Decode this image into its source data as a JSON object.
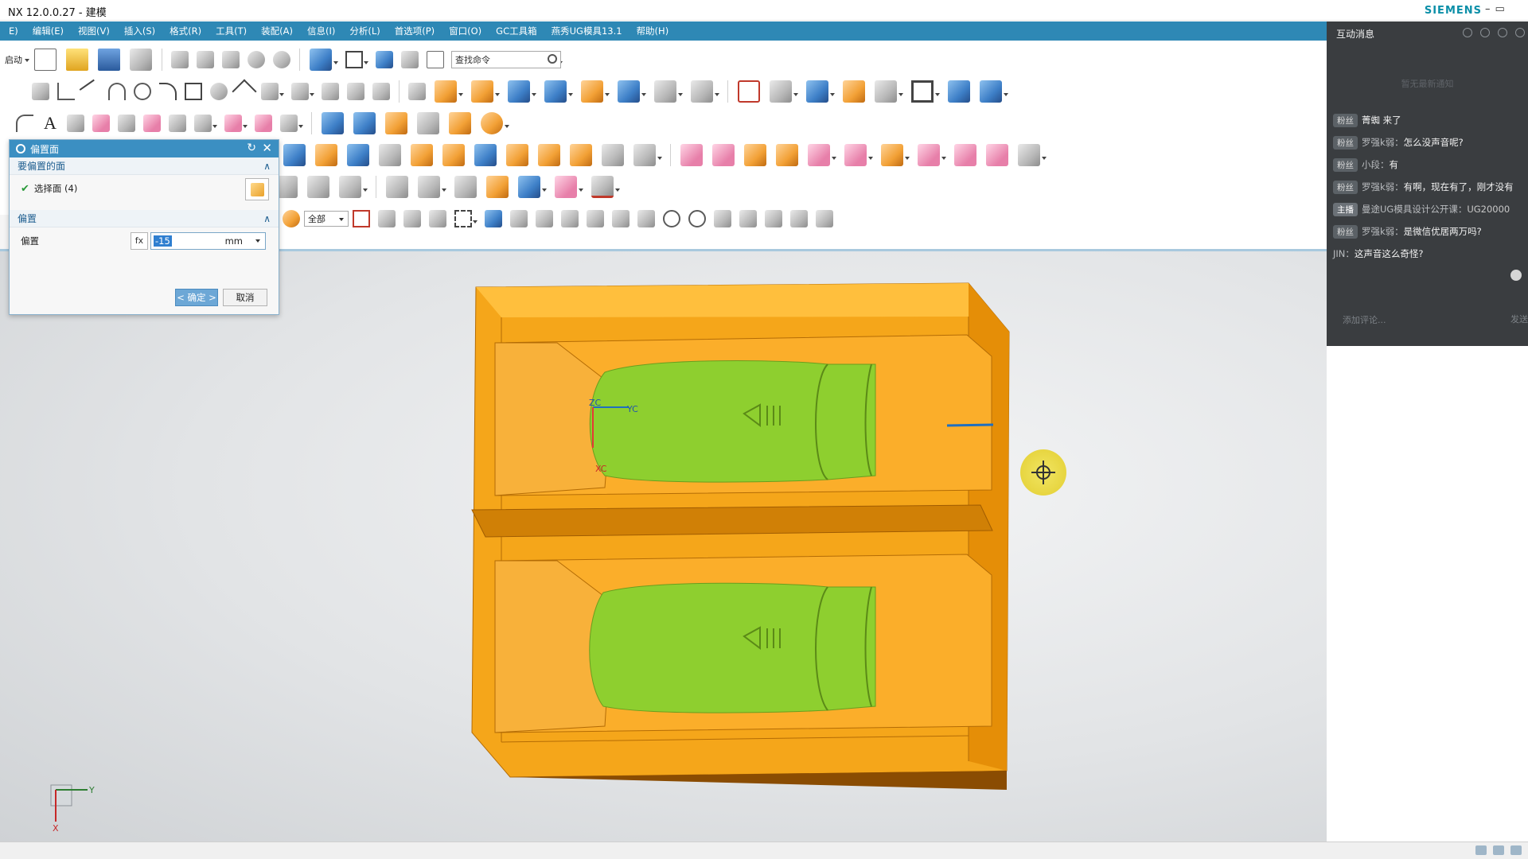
{
  "window": {
    "title": "NX 12.0.0.27 - 建模",
    "brand": "SIEMENS",
    "minimize": "–",
    "restore": "▭"
  },
  "menu": [
    "E)",
    "编辑(E)",
    "视图(V)",
    "插入(S)",
    "格式(R)",
    "工具(T)",
    "装配(A)",
    "信息(I)",
    "分析(L)",
    "首选项(P)",
    "窗口(O)",
    "GC工具箱",
    "燕秀UG模具13.1",
    "帮助(H)"
  ],
  "toolbar": {
    "start_label": "启动",
    "search_placeholder": "查找命令",
    "filter_value": "全部"
  },
  "dialog": {
    "title": "偏置面",
    "reset_icon": "↻",
    "close_icon": "✕",
    "group1_title": "要偏置的面",
    "select_label": "选择面 (4)",
    "group2_title": "偏置",
    "offset_label": "偏置",
    "offset_value": "-15",
    "unit": "mm",
    "fx_icon": "fx",
    "ok_label": "< 确定 >",
    "cancel_label": "取消",
    "collapse_icon": "∧"
  },
  "chat": {
    "title": "互动消息",
    "empty_hint": "暂无最新通知",
    "messages": [
      {
        "badge": "粉丝",
        "host": false,
        "name": "",
        "text": "菁蜘 来了"
      },
      {
        "badge": "粉丝",
        "host": false,
        "name": "罗强k弱：",
        "text": "怎么没声音呢?"
      },
      {
        "badge": "粉丝",
        "host": false,
        "name": "小段：",
        "text": "有"
      },
      {
        "badge": "粉丝",
        "host": false,
        "name": "罗强k弱：",
        "text": "有啊，现在有了，刚才没有"
      },
      {
        "badge": "主播",
        "host": true,
        "name": "曼途UG模具设计公开课：",
        "text": "UG20000"
      },
      {
        "badge": "粉丝",
        "host": false,
        "name": "罗强k弱：",
        "text": "是微信优居两万吗?"
      },
      {
        "badge": "",
        "host": false,
        "name": "JIN：",
        "text": "这声音这么奇怪?"
      }
    ],
    "input_placeholder": "添加评论...",
    "send_label": "发送"
  },
  "viewport": {
    "triad_x": "X",
    "triad_y": "Y",
    "wcs_xc": "XC",
    "wcs_yc": "YC",
    "wcs_zc": "ZC"
  },
  "colors": {
    "menu_bg": "#2e88b5",
    "dialog_title": "#3b8fc2",
    "block_orange": "#f5a61a",
    "part_green": "#8fd12e",
    "chat_bg": "#3a3d40"
  }
}
